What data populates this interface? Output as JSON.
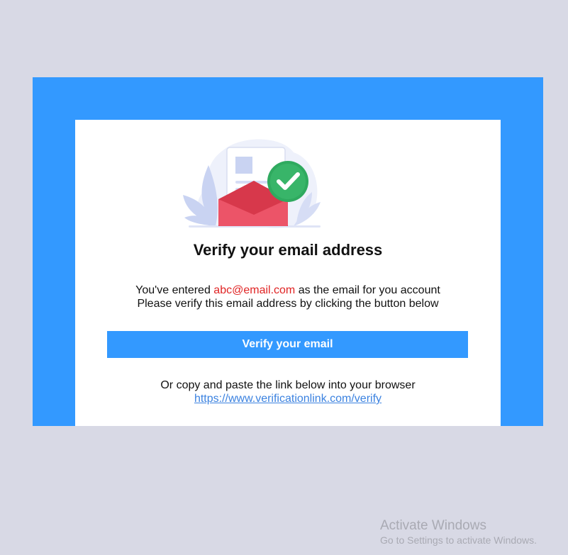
{
  "email_card": {
    "title": "Verify your email address",
    "message_prefix": "You've entered",
    "email": "abc@email.com",
    "message_suffix": "as the email for you account",
    "message_line2": "Please verify this email address by clicking the button below",
    "button_label": "Verify your email",
    "alt_text": "Or copy and paste the link below into your browser",
    "link": "https://www.verificationlink.com/verify"
  },
  "watermark": {
    "title": "Activate Windows",
    "subtitle": "Go to Settings to activate Windows."
  },
  "colors": {
    "page_background": "#d8d9e5",
    "frame": "#3399ff",
    "button": "#3399ff",
    "email_highlight": "#e02424",
    "link": "#3b82e0",
    "envelope": "#e8485b",
    "checkmark_badge": "#2faa5f"
  },
  "icons": {
    "hero": "email-verified-illustration",
    "badge": "checkmark-icon"
  }
}
